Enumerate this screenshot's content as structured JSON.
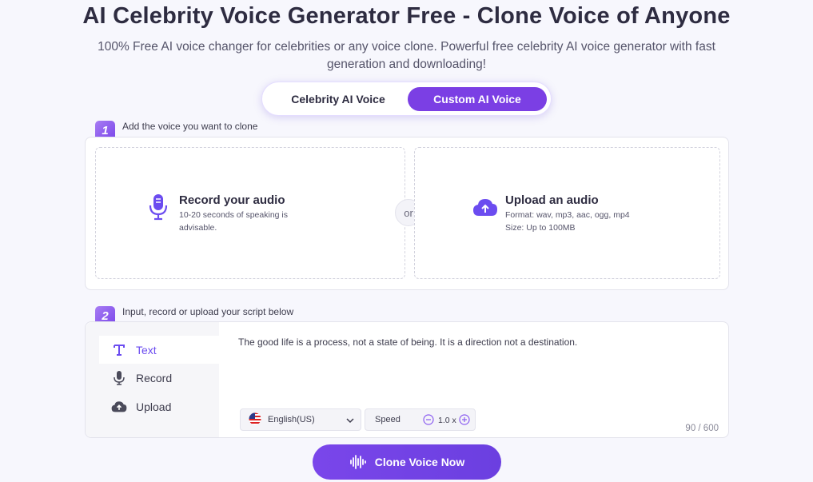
{
  "header": {
    "title": "AI Celebrity Voice Generator Free - Clone Voice of Anyone",
    "subtitle": "100% Free AI voice changer for celebrities or any voice clone. Powerful free celebrity AI voice generator with fast generation and downloading!"
  },
  "toggle": {
    "option_celebrity": "Celebrity AI Voice",
    "option_custom": "Custom AI Voice",
    "selected": "Custom AI Voice"
  },
  "step1": {
    "number": "1",
    "label": "Add the voice you want to clone",
    "record": {
      "title": "Record your audio",
      "desc": "10-20 seconds of speaking is advisable.",
      "icon": "microphone-icon"
    },
    "divider": "or",
    "upload": {
      "title": "Upload an audio",
      "format": "Format: wav, mp3, aac, ogg, mp4",
      "size": "Size: Up to 100MB",
      "icon": "cloud-upload-icon"
    }
  },
  "step2": {
    "number": "2",
    "label": "Input, record or upload your script below",
    "tabs": [
      {
        "label": "Text",
        "icon": "text-icon",
        "active": true
      },
      {
        "label": "Record",
        "icon": "microphone-icon",
        "active": false
      },
      {
        "label": "Upload",
        "icon": "cloud-upload-icon",
        "active": false
      }
    ],
    "script_text": "The good life is a process, not a state of being. It is a direction not a destination.",
    "language": "English(US)",
    "speed_label": "Speed",
    "speed_value": "1.0 x",
    "char_count": "90 / 600"
  },
  "action": {
    "label": "Clone Voice Now"
  },
  "colors": {
    "accent": "#7b3fe4",
    "background": "#f7f7fd"
  }
}
